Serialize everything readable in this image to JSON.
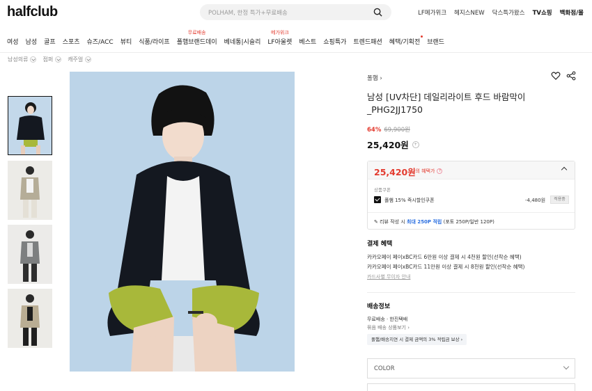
{
  "header": {
    "logo": "halfclub",
    "search_placeholder": "POLHAM, 한정 특가+무료배송",
    "util_links": [
      "LF메가위크",
      "헤지스NEW",
      "닥스특가왔스",
      "TV쇼핑",
      "백화점/몰"
    ]
  },
  "nav": [
    {
      "label": "여성"
    },
    {
      "label": "남성"
    },
    {
      "label": "골프"
    },
    {
      "label": "스포츠"
    },
    {
      "label": "슈즈/ACC"
    },
    {
      "label": "뷰티"
    },
    {
      "label": "식품/라이프"
    },
    {
      "label": "폴햄브랜드데이",
      "tag": "무료배송"
    },
    {
      "label": "베네통|시슬리"
    },
    {
      "label": "LF아울렛",
      "tag": "메가위크"
    },
    {
      "label": "베스트"
    },
    {
      "label": "쇼핑특가"
    },
    {
      "label": "트렌드패션"
    },
    {
      "label": "혜택/기획전",
      "dot": true
    },
    {
      "label": "브랜드"
    }
  ],
  "breadcrumb": [
    "남성의류",
    "점퍼",
    "캐주얼"
  ],
  "product": {
    "brand": "폴햄",
    "title": "남성 [UV차단] 데일리라이트 후드 바람막이 _PHG2JJ1750",
    "discount_pct": "64%",
    "original_price": "69,900원",
    "price": "25,420원"
  },
  "benefit_box": {
    "best_price": "25,420원",
    "best_label": "나의 혜택가",
    "coupon_section_label": "상품쿠폰",
    "coupon_name": "폴햄 15% 즉시할인쿠폰",
    "coupon_amount": "-4,480원",
    "coupon_button": "적용중",
    "review_prefix": "리뷰 작성 시 ",
    "review_highlight": "최대 250P 적립",
    "review_suffix": " (포토 250P/일반 120P)"
  },
  "payment": {
    "title": "결제 혜택",
    "lines": [
      "카카오페이 페이xBC카드 6만원 이상 결제 시 4천원 할인(선착순 혜택)",
      "카카오페이 페이xBC카드 11만원 이상 결제 시 8천원 할인(선착순 혜택)"
    ],
    "link": "카드사별 무이자 안내"
  },
  "shipping": {
    "title": "배송정보",
    "line1": "무료배송 · 한진택배",
    "line2": "묶음 배송 상품보기 ›",
    "badge": "폴햄/배송지연 시 결제 금액의 3% 적립금 보상 ›"
  },
  "option": {
    "label": "COLOR"
  },
  "colors": {
    "accent_red": "#e33b2f",
    "link_blue": "#2b6fe0",
    "bg_photo": "#bcd4e8",
    "jacket": "#141820",
    "shorts": "#a8b83a"
  }
}
